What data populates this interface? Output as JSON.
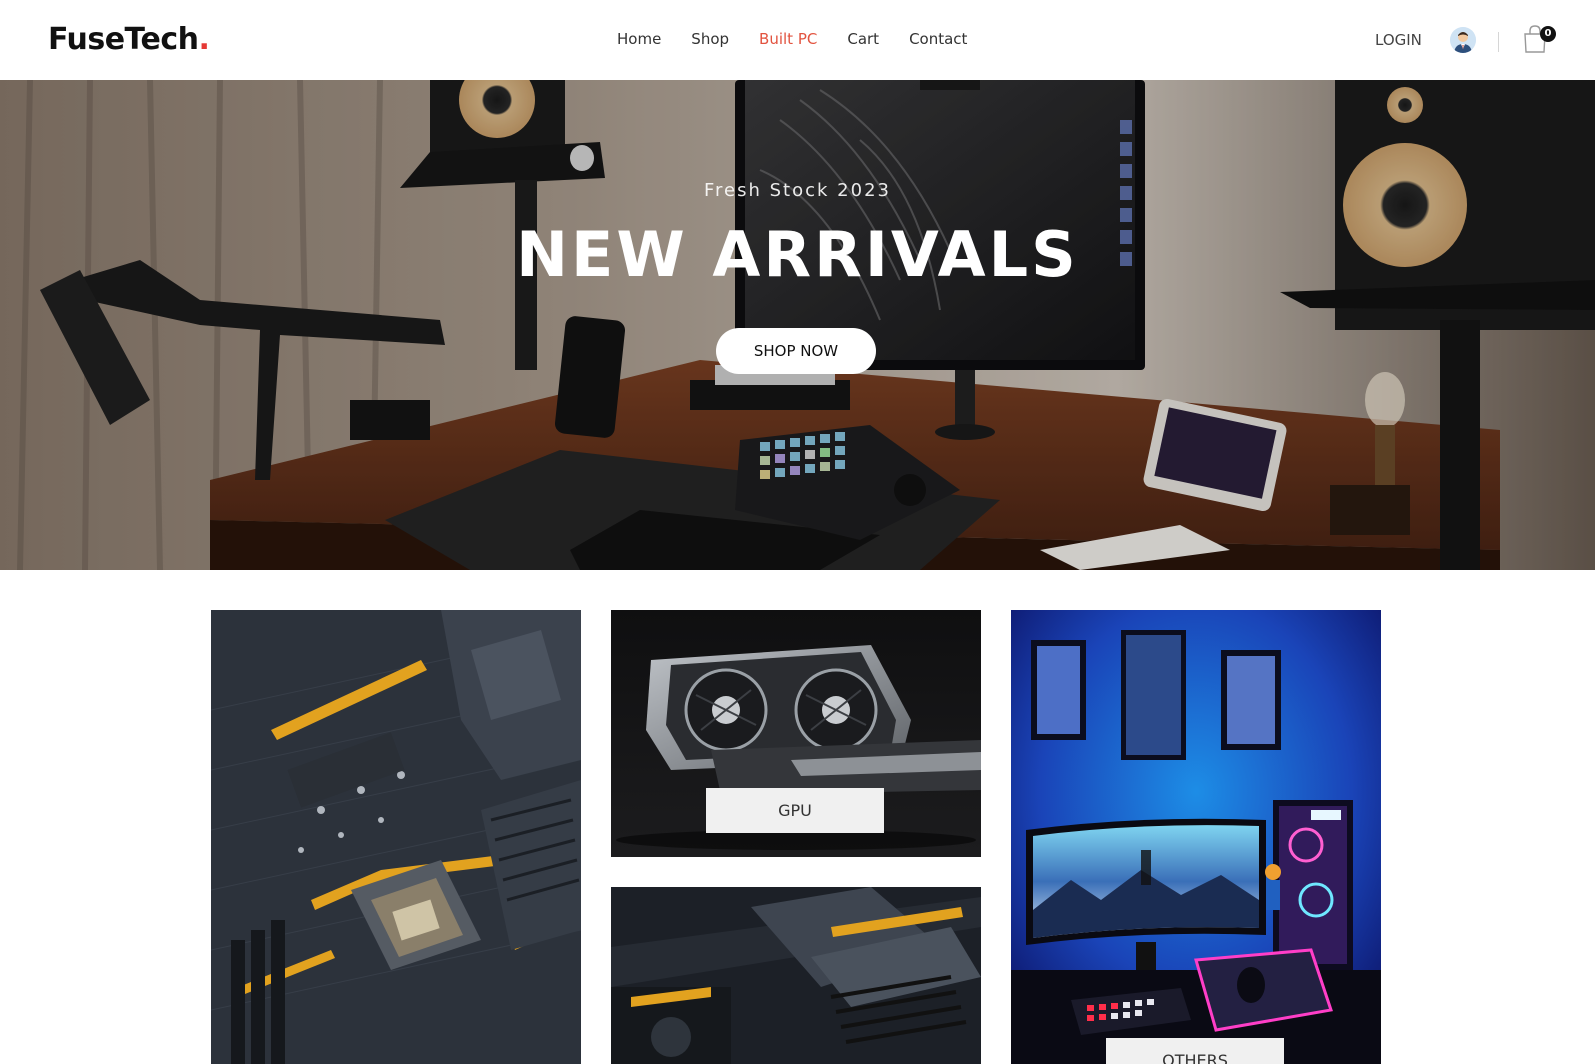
{
  "header": {
    "logo_text": "FuseTech",
    "logo_dot": ".",
    "nav": [
      {
        "label": "Home",
        "active": false
      },
      {
        "label": "Shop",
        "active": false
      },
      {
        "label": "Built PC",
        "active": true
      },
      {
        "label": "Cart",
        "active": false
      },
      {
        "label": "Contact",
        "active": false
      }
    ],
    "login_label": "LOGIN",
    "cart_count": "0",
    "accent_color": "#e2533f"
  },
  "hero": {
    "subtitle": "Fresh Stock 2023",
    "title": "NEW ARRIVALS",
    "cta_label": "SHOP NOW"
  },
  "categories": [
    {
      "id": "motherboard",
      "label": ""
    },
    {
      "id": "gpu",
      "label": "GPU"
    },
    {
      "id": "others",
      "label": "OTHERS"
    },
    {
      "id": "gaming-board",
      "label": ""
    }
  ]
}
